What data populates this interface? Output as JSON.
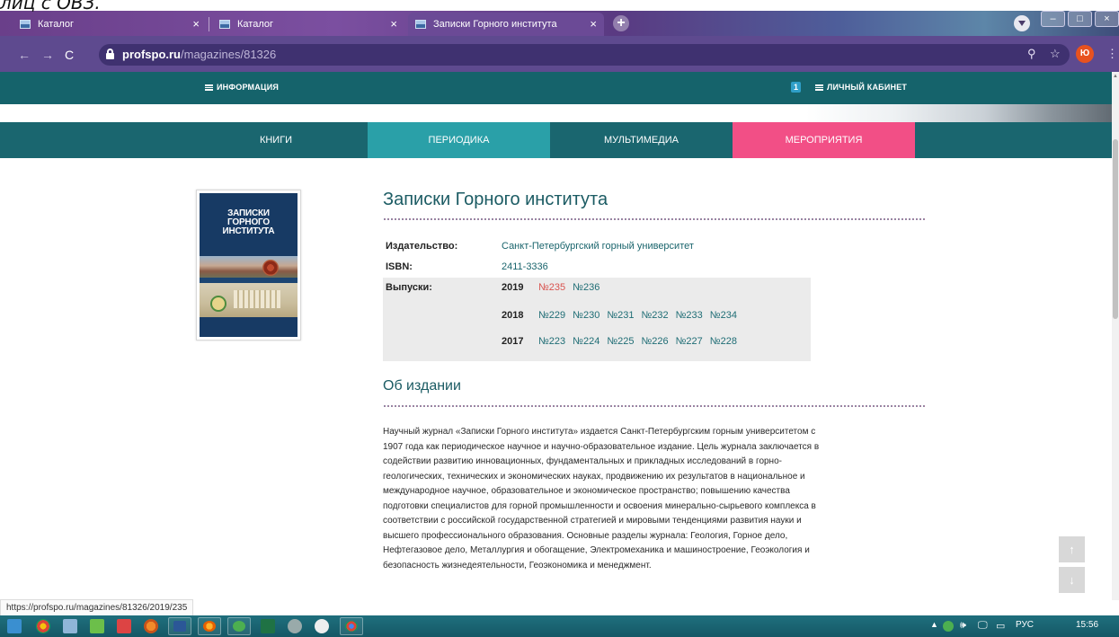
{
  "caption": "лиц с ОВЗ.",
  "browser": {
    "tabs": [
      {
        "title": "Каталог",
        "active": false
      },
      {
        "title": "Каталог",
        "active": false
      },
      {
        "title": "Записки Горного института",
        "active": true
      }
    ],
    "url_domain": "profspo.ru",
    "url_path": "/magazines/81326",
    "avatar_letter": "Ю",
    "status_url": "https://profspo.ru/magazines/81326/2019/235"
  },
  "site": {
    "top_left": "ИНФОРМАЦИЯ",
    "cart_count": "1",
    "top_right": "ЛИЧНЫЙ КАБИНЕТ",
    "nav": [
      {
        "label": "КНИГИ"
      },
      {
        "label": "ПЕРИОДИКА"
      },
      {
        "label": "МУЛЬТИМЕДИА"
      },
      {
        "label": "МЕРОПРИЯТИЯ"
      }
    ]
  },
  "cover": {
    "title_lines": [
      "ЗАПИСКИ",
      "ГОРНОГО",
      "ИНСТИТУТА"
    ]
  },
  "journal": {
    "title": "Записки Горного института",
    "publisher_label": "Издательство:",
    "publisher": "Санкт-Петербургский горный университет",
    "isbn_label": "ISBN:",
    "isbn": "2411-3336",
    "issues_label": "Выпуски:",
    "years": [
      {
        "year": "2019",
        "issues": [
          "№235",
          "№236"
        ],
        "visited": [
          true,
          false
        ]
      },
      {
        "year": "2018",
        "issues": [
          "№229",
          "№230",
          "№231",
          "№232",
          "№233",
          "№234"
        ],
        "visited": [
          false,
          false,
          false,
          false,
          false,
          false
        ]
      },
      {
        "year": "2017",
        "issues": [
          "№223",
          "№224",
          "№225",
          "№226",
          "№227",
          "№228"
        ],
        "visited": [
          false,
          false,
          false,
          false,
          false,
          false
        ]
      }
    ],
    "about_heading": "Об издании",
    "about_lines": [
      "Научный журнал «Записки Горного института» издается Санкт-Петербургским горным университетом с",
      "1907 года как периодическое научное и научно-образовательное издание. Цель журнала заключается в",
      "содействии развитию инновационных, фундаментальных и прикладных исследований в горно-",
      "геологических, технических и экономических науках, продвижению их результатов в национальное и",
      "международное научное, образовательное и экономическое пространство; повышению качества",
      "подготовки специалистов для горной промышленности и освоения минерально-сырьевого комплекса в",
      "соответствии с российской государственной стратегией и мировыми тенденциями развития науки и",
      "высшего профессионального образования. Основные разделы журнала: Геология, Горное дело,",
      "Нефтегазовое дело, Металлургия и обогащение, Электромеханика и машиностроение, Геоэкология и",
      "безопасность жизнедеятельности, Геоэкономика и менеджмент."
    ]
  },
  "taskbar": {
    "lang": "РУС",
    "time": "15:56"
  },
  "colors": {
    "teal_dark": "#15636b",
    "teal_active": "#2aa0a8",
    "pink": "#f24f86",
    "link": "#1f6d75",
    "visited": "#d9534f"
  }
}
